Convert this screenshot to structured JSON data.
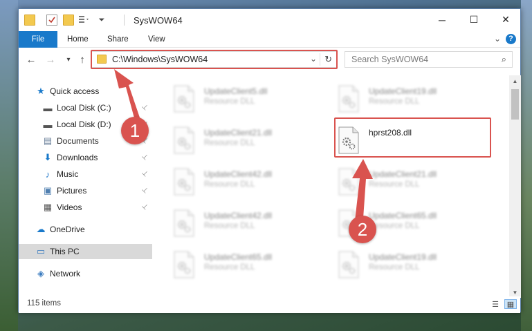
{
  "window": {
    "title": "SysWOW64",
    "controls": {
      "minimize": "─",
      "maximize": "☐",
      "close": "✕"
    }
  },
  "ribbon": {
    "tabs": [
      "File",
      "Home",
      "Share",
      "View"
    ],
    "expand_icon": "chevron-down-icon",
    "help": "?"
  },
  "nav": {
    "back": "←",
    "forward": "→",
    "recent": "▾",
    "up": "↑",
    "address": "C:\\Windows\\SysWOW64",
    "address_dropdown": "⌄",
    "refresh": "↻",
    "search_placeholder": "Search SysWOW64",
    "search_icon": "⌕"
  },
  "sidebar": {
    "items": [
      {
        "label": "Quick access",
        "icon": "star-icon",
        "glyph": "★",
        "pinned": false
      },
      {
        "label": "Local Disk (C:)",
        "icon": "drive-icon",
        "glyph": "▬",
        "pinned": true
      },
      {
        "label": "Local Disk (D:)",
        "icon": "drive-icon",
        "glyph": "▬",
        "pinned": true
      },
      {
        "label": "Documents",
        "icon": "documents-icon",
        "glyph": "▤",
        "pinned": true
      },
      {
        "label": "Downloads",
        "icon": "download-icon",
        "glyph": "⬇",
        "pinned": true
      },
      {
        "label": "Music",
        "icon": "music-icon",
        "glyph": "♪",
        "pinned": true
      },
      {
        "label": "Pictures",
        "icon": "pictures-icon",
        "glyph": "▣",
        "pinned": true
      },
      {
        "label": "Videos",
        "icon": "videos-icon",
        "glyph": "▦",
        "pinned": true
      },
      {
        "label": "OneDrive",
        "icon": "cloud-icon",
        "glyph": "☁",
        "pinned": false
      },
      {
        "label": "This PC",
        "icon": "computer-icon",
        "glyph": "▭",
        "pinned": false,
        "selected": true
      },
      {
        "label": "Network",
        "icon": "network-icon",
        "glyph": "◈",
        "pinned": false
      }
    ],
    "pin_glyph": "📌"
  },
  "files": [
    {
      "name": "UpdateClient5.dll",
      "type": "Resource DLL",
      "blurred": true
    },
    {
      "name": "UpdateClient19.dll",
      "type": "Resource DLL",
      "blurred": true
    },
    {
      "name": "UpdateClient21.dll",
      "type": "Resource DLL",
      "blurred": true
    },
    {
      "name": "hprst208.dll",
      "type": "",
      "blurred": false,
      "highlighted": true
    },
    {
      "name": "UpdateClient42.dll",
      "type": "Resource DLL",
      "blurred": true
    },
    {
      "name": "UpdateClient21.dll",
      "type": "Resource DLL",
      "blurred": true
    },
    {
      "name": "UpdateClient42.dll",
      "type": "Resource DLL",
      "blurred": true
    },
    {
      "name": "UpdateClient65.dll",
      "type": "Resource DLL",
      "blurred": true
    },
    {
      "name": "UpdateClient65.dll",
      "type": "Resource DLL",
      "blurred": true
    },
    {
      "name": "UpdateClient19.dll",
      "type": "Resource DLL",
      "blurred": true
    }
  ],
  "status": {
    "item_count": "115 items",
    "details_view": "☰",
    "icons_view": "▦"
  },
  "annotations": {
    "step1": "1",
    "step2": "2",
    "color": "#d9534f"
  },
  "colors": {
    "accent": "#1979ca",
    "highlight": "#d9534f",
    "folder": "#f3c94f"
  }
}
